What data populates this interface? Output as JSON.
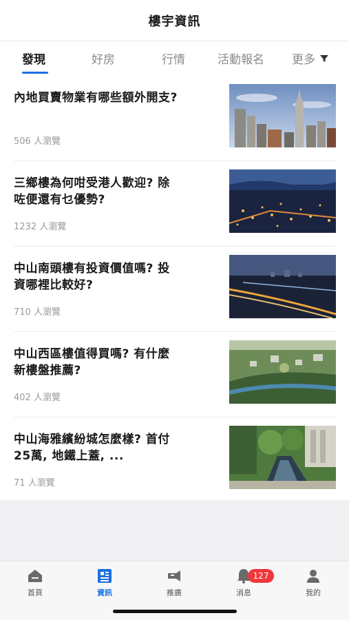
{
  "header": {
    "title": "樓宇資訊"
  },
  "tabs": [
    {
      "label": "發現"
    },
    {
      "label": "好房"
    },
    {
      "label": "行情"
    },
    {
      "label": "活動報名"
    }
  ],
  "tab_more": {
    "label": "更多",
    "icon": "filter-icon"
  },
  "articles": [
    {
      "title": "內地買賣物業有哪些額外開支?",
      "views": "506 人瀏覽",
      "image": "city-skyline-image"
    },
    {
      "title": "三鄉樓為何咁受港人歡迎? 除咗便還有乜優勢?",
      "views": "1232 人瀏覽",
      "image": "night-town-image"
    },
    {
      "title": "中山南頭樓有投資價值嗎? 投資哪裡比較好?",
      "views": "710 人瀏覽",
      "image": "night-bridge-image"
    },
    {
      "title": "中山西區樓值得買嗎? 有什麼新樓盤推薦?",
      "views": "402 人瀏覽",
      "image": "park-aerial-image"
    },
    {
      "title": "中山海雅繽紛城怎麼樣? 首付25萬, 地鐵上蓋, ...",
      "views": "71 人瀏覽",
      "image": "garden-pool-image"
    }
  ],
  "tabbar": {
    "items": [
      {
        "label": "首頁",
        "icon": "home-icon"
      },
      {
        "label": "資訊",
        "icon": "news-icon"
      },
      {
        "label": "推廣",
        "icon": "promote-icon"
      },
      {
        "label": "消息",
        "icon": "bell-icon",
        "badge": "127"
      },
      {
        "label": "我的",
        "icon": "person-icon"
      }
    ]
  },
  "colors": {
    "accent": "#1a6fe0",
    "badge": "#f0373a"
  }
}
